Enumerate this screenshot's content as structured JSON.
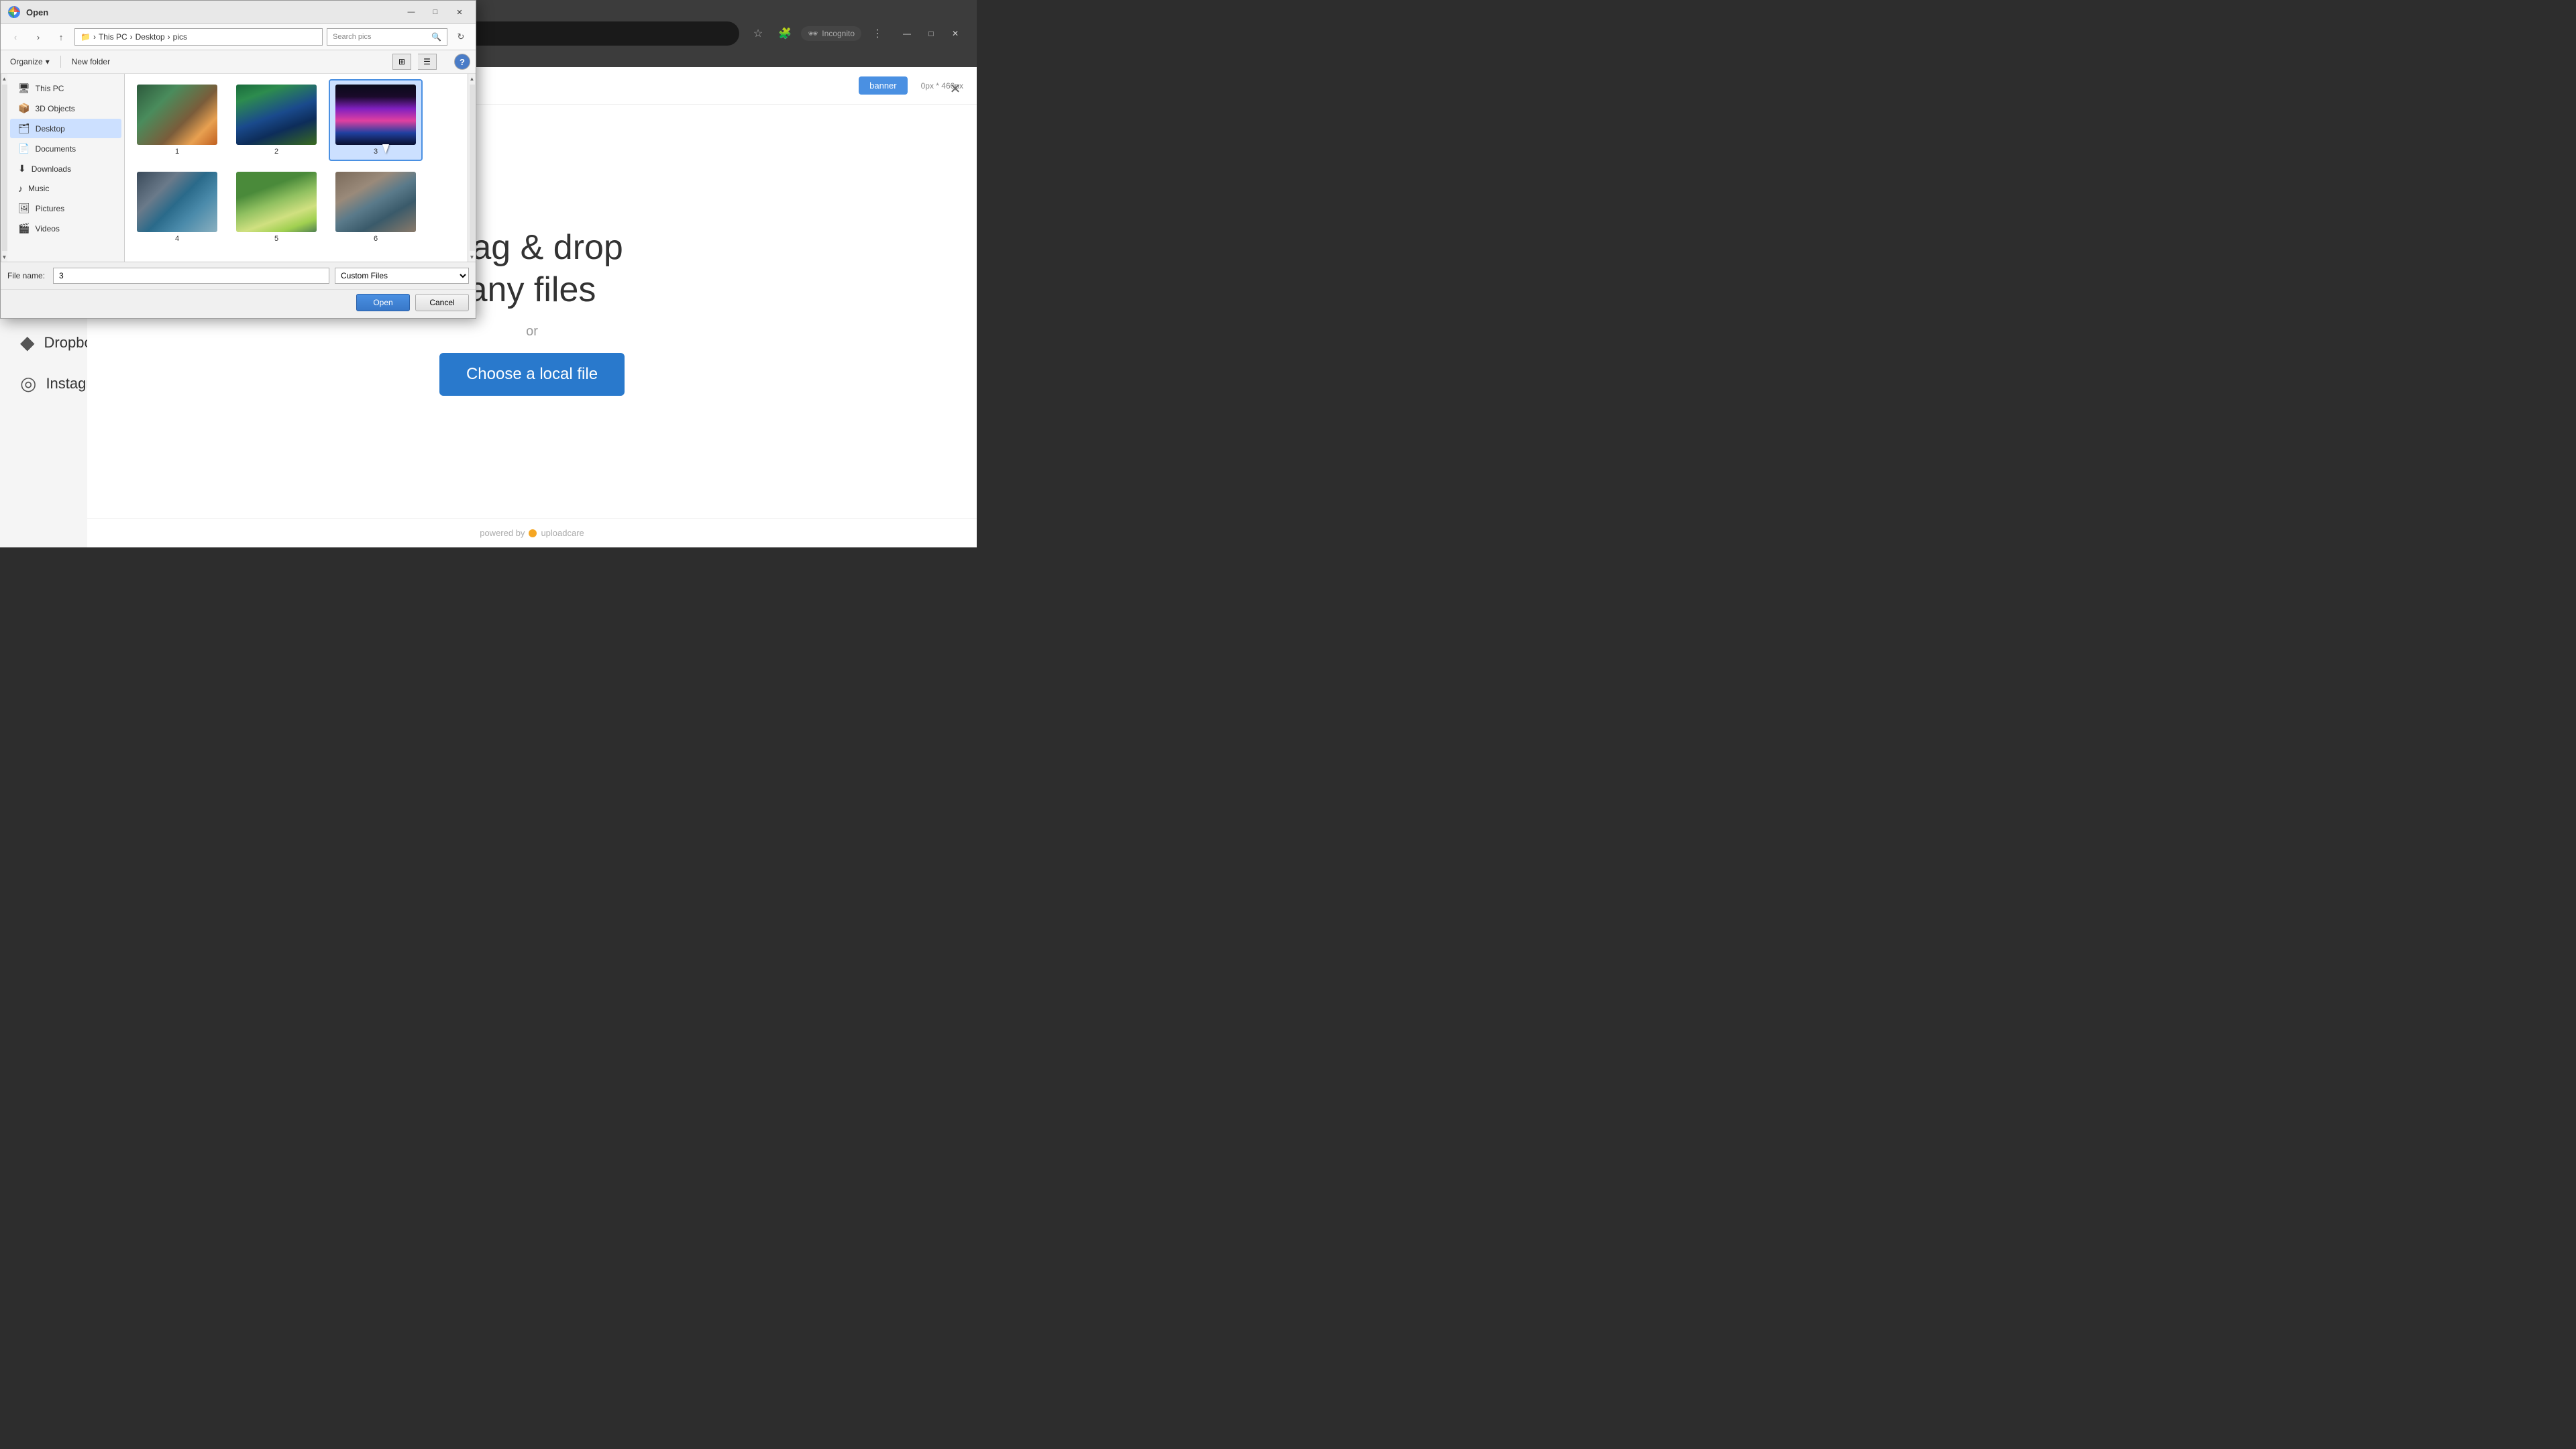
{
  "browser": {
    "title": "Incognito",
    "nav": {
      "back": "‹",
      "forward": "›",
      "up": "↑",
      "refresh": "↻"
    },
    "incognito_label": "Incognito",
    "win_controls": {
      "minimize": "—",
      "maximize": "□",
      "close": "✕"
    }
  },
  "win_dialog": {
    "title": "Open",
    "breadcrumb": {
      "this_pc": "This PC",
      "desktop": "Desktop",
      "pics": "pics",
      "separator": "›"
    },
    "search_placeholder": "Search pics",
    "toolbar": {
      "organize": "Organize",
      "new_folder": "New folder"
    },
    "nav_items": [
      {
        "label": "This PC",
        "icon": "🖥"
      },
      {
        "label": "3D Objects",
        "icon": "📦"
      },
      {
        "label": "Desktop",
        "icon": "🗂",
        "selected": true
      },
      {
        "label": "Documents",
        "icon": "📄"
      },
      {
        "label": "Downloads",
        "icon": "⬇"
      },
      {
        "label": "Music",
        "icon": "♪"
      },
      {
        "label": "Pictures",
        "icon": "🖼"
      },
      {
        "label": "Videos",
        "icon": "🎬"
      }
    ],
    "files": [
      {
        "name": "1",
        "thumb_class": "thumb-1"
      },
      {
        "name": "2",
        "thumb_class": "thumb-2"
      },
      {
        "name": "3",
        "thumb_class": "thumb-3",
        "selected": true
      },
      {
        "name": "4",
        "thumb_class": "thumb-4"
      },
      {
        "name": "5",
        "thumb_class": "thumb-5"
      },
      {
        "name": "6",
        "thumb_class": "thumb-6"
      }
    ],
    "filename_label": "File name:",
    "filename_value": "3",
    "filetype_value": "Custom Files",
    "btn_open": "Open",
    "btn_cancel": "Cancel",
    "win_controls": {
      "minimize": "—",
      "maximize": "□",
      "close": "✕"
    }
  },
  "uploadcare": {
    "close_icon": "✕",
    "drag_text": "drag & drop\nany files",
    "or_text": "or",
    "choose_btn_label": "Choose a local file",
    "footer_text": "powered by",
    "footer_brand": "uploadcare",
    "banner_btn": "banner",
    "size_info": "0px * 460px"
  },
  "sidebar": {
    "items": [
      {
        "label": "Dropbox",
        "icon": "◆"
      },
      {
        "label": "Instagram",
        "icon": "◎"
      }
    ]
  }
}
